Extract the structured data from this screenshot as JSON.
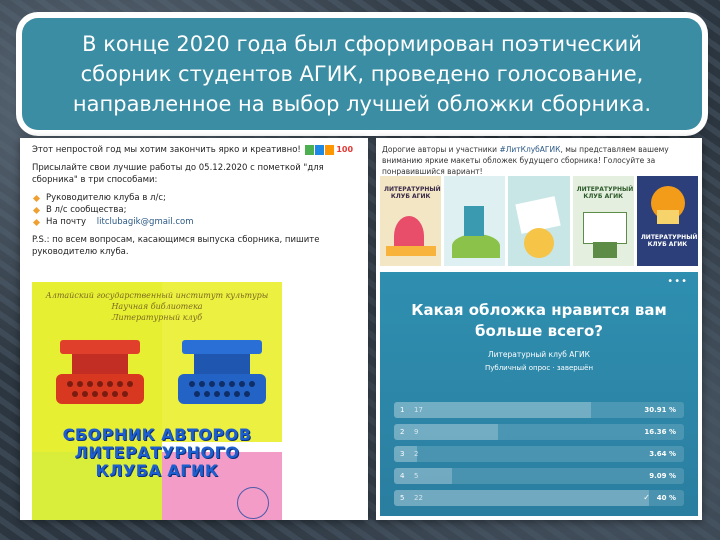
{
  "banner": {
    "text": "В конце 2020 года был сформирован поэтический\nсборник студентов АГИК, проведено голосование,\nнаправленное на выбор лучшей обложки сборника."
  },
  "left_post": {
    "line1": "Этот непростой год мы хотим закончить ярко и креативно!",
    "line2": "Присылайте свои лучшие работы до 05.12.2020 с пометкой \"для сборника\" в три способами:",
    "methods": [
      "Руководителю клуба в л/с;",
      "В л/с сообщества;"
    ],
    "email_label": "На почту",
    "email": "litclubagik@gmail.com",
    "ps": "P.S.: по всем вопросам, касающимся выпуска сборника, пишите руководителю клуба.",
    "book_colors": [
      "#4caf50",
      "#1e88e5",
      "#ff9800"
    ]
  },
  "cover": {
    "header": "Алтайский государственный институт культуры\nНаучная библиотека\nЛитературный клуб",
    "title": "СБОРНИК АВТОРОВ\nЛИТЕРАТУРНОГО\nКЛУБА АГИК"
  },
  "right_post": {
    "text_prefix": "Дорогие авторы и участники",
    "hashtag": "#ЛитКлубАГИК",
    "text_suffix": ", мы представляем вашему вниманию яркие макеты обложек будущего сборника! Голосуйте за понравившийся вариант!"
  },
  "thumbs": [
    {
      "title": "ЛИТЕРАТУРНЫЙ\nКЛУБ АГИК",
      "bg": "#f2e6c4",
      "accent": "#e84d6a"
    },
    {
      "title": "",
      "bg": "#dff0f2",
      "accent": "#3a9ab0"
    },
    {
      "title": "",
      "bg": "#c9e6e6",
      "accent": "#f6c447"
    },
    {
      "title": "ЛИТЕРАТУРНЫЙ\nКЛУБ АГИК",
      "bg": "#e4efe0",
      "accent": "#5c8c46"
    },
    {
      "title": "ЛИТЕРАТУРНЫЙ\nКЛУБ АГИК",
      "bg": "#2c3f7a",
      "accent": "#f39c1a"
    }
  ],
  "poll": {
    "more": "•••",
    "question": "Какая обложка нравится вам\nбольше всего?",
    "author": "Литературный клуб АГИК",
    "meta": "Публичный опрос · завершён",
    "options": [
      {
        "index": "1",
        "count": "17",
        "percent": "30.91 %",
        "share": 0.3091,
        "checked": false
      },
      {
        "index": "2",
        "count": "9",
        "percent": "16.36 %",
        "share": 0.1636,
        "checked": false
      },
      {
        "index": "3",
        "count": "2",
        "percent": "3.64 %",
        "share": 0.0364,
        "checked": false
      },
      {
        "index": "4",
        "count": "5",
        "percent": "9.09 %",
        "share": 0.0909,
        "checked": false
      },
      {
        "index": "5",
        "count": "22",
        "percent": "40 %",
        "share": 0.4,
        "checked": true
      }
    ]
  }
}
